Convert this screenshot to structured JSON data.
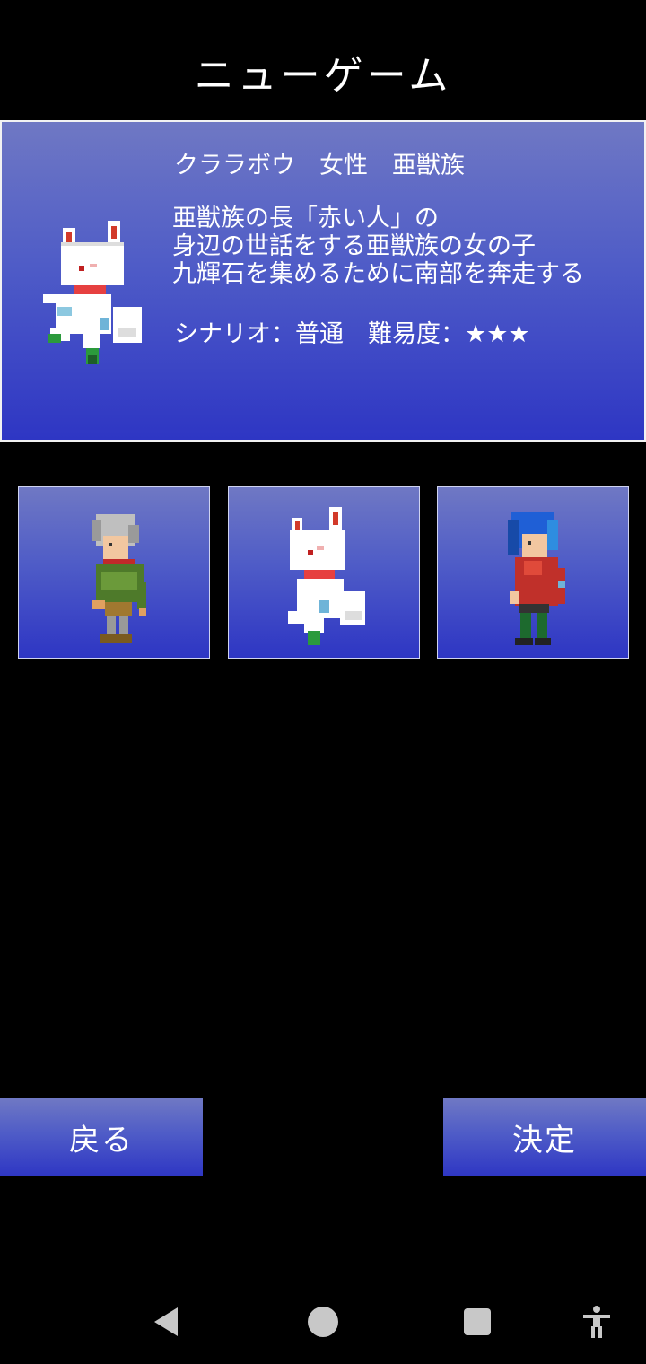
{
  "screen": {
    "title": "ニューゲーム"
  },
  "selected_character": {
    "header": "クララボウ　女性　亜獣族",
    "description": [
      "亜獣族の長「赤い人」の",
      "身辺の世話をする亜獣族の女の子",
      "九輝石を集めるために南部を奔走する"
    ],
    "meta": "シナリオ：普通　難易度：★★★"
  },
  "characters": [
    {
      "sprite": "gray-haired-boy-green-coat-sprite"
    },
    {
      "sprite": "white-fox-girl-sprite"
    },
    {
      "sprite": "blue-haired-boy-red-coat-sprite"
    }
  ],
  "buttons": {
    "back_label": "戻る",
    "confirm_label": "決定"
  },
  "navbar": {
    "icons": [
      "back-triangle-icon",
      "home-circle-icon",
      "recents-square-icon",
      "accessibility-icon"
    ]
  },
  "colors": {
    "panel_top": "#6f78c4",
    "panel_bottom": "#2e36c4",
    "background": "#000000",
    "text": "#ffffff"
  }
}
